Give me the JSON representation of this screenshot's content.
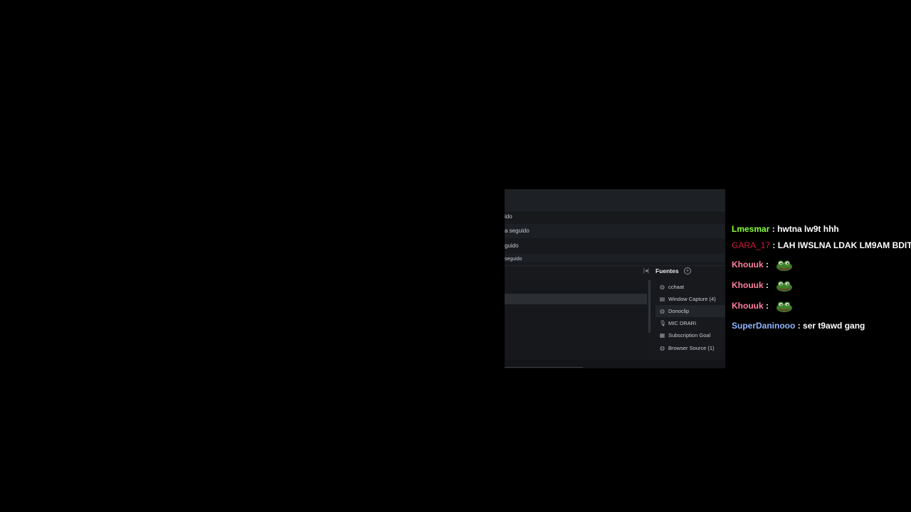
{
  "obs_window": {
    "events": [
      {
        "text": "ido"
      },
      {
        "text": "a seguido"
      },
      {
        "text": "guido"
      },
      {
        "text": "seguido"
      }
    ],
    "sources_panel": {
      "title": "Fuentes",
      "header_left_icon": "filter-icon",
      "header_add_icon": "add-circle-icon",
      "items": [
        {
          "label": "cchaat",
          "icon": "globe-icon",
          "selected": false
        },
        {
          "label": "Window Capture (4)",
          "icon": "window-icon",
          "selected": false
        },
        {
          "label": "Donoclip",
          "icon": "globe-icon",
          "selected": true
        },
        {
          "label": "MIC DRARI",
          "icon": "microphone-icon",
          "selected": false
        },
        {
          "label": "Subscription Goal",
          "icon": "calendar-icon",
          "selected": false
        },
        {
          "label": "Browser Source (1)",
          "icon": "globe-icon",
          "selected": false
        }
      ]
    }
  },
  "chat": {
    "messages": [
      {
        "user": "Lmesmar",
        "color": "#8bff3a",
        "text": "hwtna lw9t hhh",
        "emote": null
      },
      {
        "user": "GARA_17",
        "color": "#d41a3a",
        "text": "LAH IWSLNA LDAK LM9AM BDIT",
        "emote": null
      },
      {
        "user": "Khouuk",
        "color": "#ff7fa0",
        "text": "",
        "emote": "pepe-frog-emote"
      },
      {
        "user": "Khouuk",
        "color": "#ff7fa0",
        "text": "",
        "emote": "pepe-frog-emote"
      },
      {
        "user": "Khouuk",
        "color": "#ff7fa0",
        "text": "",
        "emote": "pepe-frog-emote"
      },
      {
        "user": "SuperDaninooo",
        "color": "#8fb6ff",
        "text": "ser t9awd gang",
        "emote": null
      }
    ],
    "separator": ":"
  }
}
